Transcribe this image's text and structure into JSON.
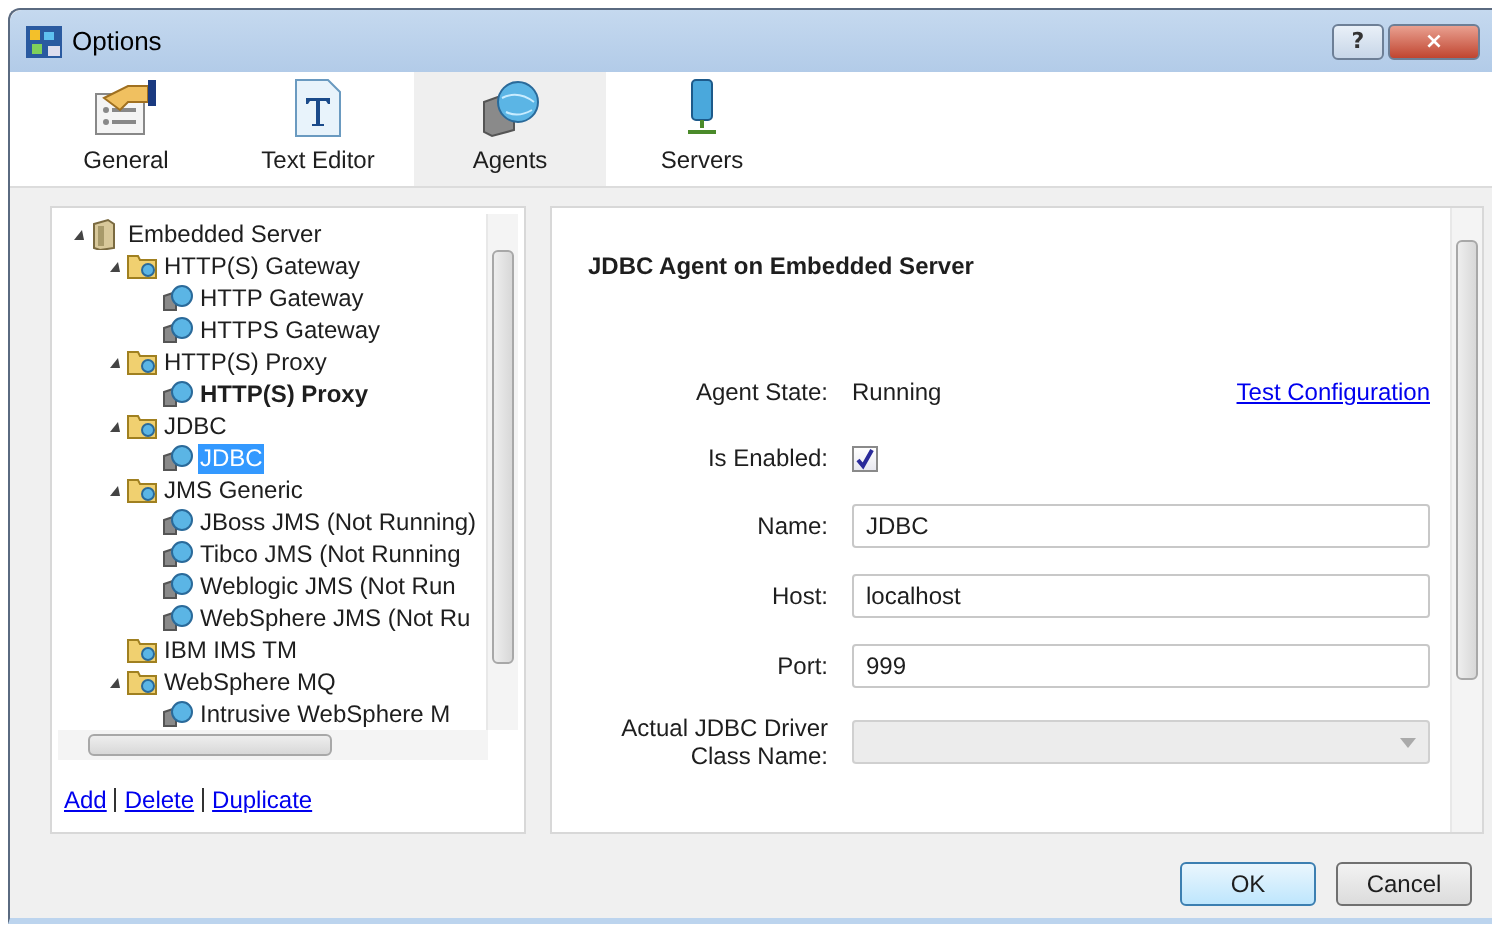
{
  "window": {
    "title": "Options",
    "buttons": [
      "?",
      "×"
    ]
  },
  "tabs": [
    {
      "label": "General",
      "kind": "general",
      "selected": false
    },
    {
      "label": "Text Editor",
      "kind": "text",
      "selected": false
    },
    {
      "label": "Agents",
      "kind": "agents",
      "selected": true
    },
    {
      "label": "Servers",
      "kind": "servers",
      "selected": false
    }
  ],
  "tree": {
    "items": [
      {
        "label": "Embedded Server",
        "kind": "server",
        "expanded": true,
        "selected": false,
        "bold": false,
        "children": [
          {
            "label": "HTTP(S) Gateway",
            "kind": "folder",
            "expanded": true,
            "selected": false,
            "bold": false,
            "children": [
              {
                "label": "HTTP Gateway",
                "kind": "agent",
                "selected": false,
                "bold": false
              },
              {
                "label": "HTTPS Gateway",
                "kind": "agent",
                "selected": false,
                "bold": false
              }
            ]
          },
          {
            "label": "HTTP(S) Proxy",
            "kind": "folder",
            "expanded": true,
            "selected": false,
            "bold": false,
            "children": [
              {
                "label": "HTTP(S) Proxy",
                "kind": "agent",
                "selected": false,
                "bold": true
              }
            ]
          },
          {
            "label": "JDBC",
            "kind": "folder",
            "expanded": true,
            "selected": false,
            "bold": false,
            "children": [
              {
                "label": "JDBC",
                "kind": "agent",
                "selected": true,
                "bold": false
              }
            ]
          },
          {
            "label": "JMS Generic",
            "kind": "folder",
            "expanded": true,
            "selected": false,
            "bold": false,
            "children": [
              {
                "label": "JBoss JMS (Not Running)",
                "kind": "agent",
                "selected": false,
                "bold": false
              },
              {
                "label": "Tibco JMS (Not Running",
                "kind": "agent",
                "selected": false,
                "bold": false
              },
              {
                "label": "Weblogic JMS (Not Run",
                "kind": "agent",
                "selected": false,
                "bold": false
              },
              {
                "label": "WebSphere JMS (Not Ru",
                "kind": "agent",
                "selected": false,
                "bold": false
              }
            ]
          },
          {
            "label": "IBM IMS TM",
            "kind": "folder",
            "selected": false,
            "bold": false
          },
          {
            "label": "WebSphere MQ",
            "kind": "folder",
            "expanded": true,
            "selected": false,
            "bold": false,
            "children": [
              {
                "label": "Intrusive WebSphere M",
                "kind": "agent",
                "selected": false,
                "bold": false
              }
            ]
          }
        ]
      }
    ],
    "links": [
      "Add",
      "Delete",
      "Duplicate"
    ]
  },
  "detail": {
    "heading": "JDBC Agent on Embedded Server",
    "fields": [
      {
        "kind": "readout",
        "label": "Agent State:",
        "value": "Running",
        "link": "Test Configuration"
      },
      {
        "kind": "checkbox",
        "label": "Is Enabled:",
        "checked": true
      },
      {
        "kind": "text",
        "label": "Name:",
        "value": "JDBC"
      },
      {
        "kind": "text",
        "label": "Host:",
        "value": "localhost"
      },
      {
        "kind": "text",
        "label": "Port:",
        "value": "999"
      },
      {
        "kind": "dropdown",
        "label": "Actual JDBC Driver Class Name:",
        "disabled": true
      }
    ]
  },
  "buttons": [
    {
      "label": "OK",
      "default": true
    },
    {
      "label": "Cancel",
      "default": false
    }
  ]
}
